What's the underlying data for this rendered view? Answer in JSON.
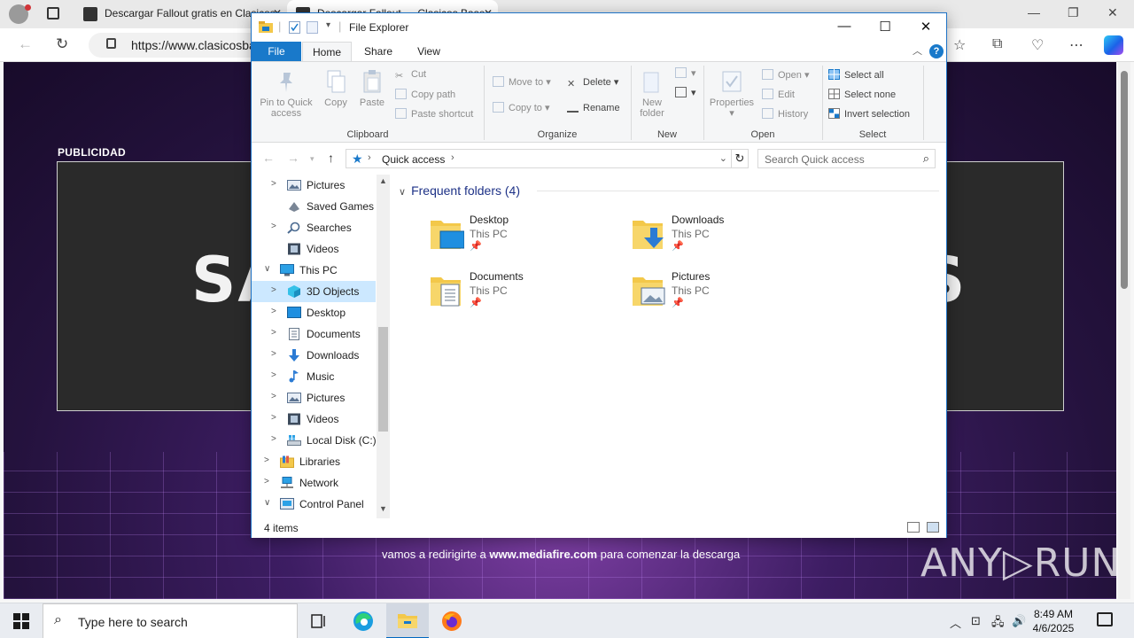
{
  "browser": {
    "tabs": [
      {
        "title": "Descargar Fallout gratis en Clasicos",
        "close": "✕"
      },
      {
        "title": "Descargar Fallout — Clasicos Base",
        "close": "✕"
      }
    ],
    "url": "https://www.clasicosba",
    "ad_label": "PUBLICIDAD",
    "hero_left": "SAY",
    "hero_right": "S",
    "redirect_text_pre": "vamos a redirigirte a",
    "redirect_site": "www.mediafire.com",
    "redirect_text_post": "para comenzar la descarga",
    "watermark": "ANY▷RUN"
  },
  "explorer": {
    "title": "File Explorer",
    "ribbon_tabs": {
      "file": "File",
      "home": "Home",
      "share": "Share",
      "view": "View"
    },
    "help": "?",
    "clipboard": {
      "pin": "Pin to Quick access",
      "copy": "Copy",
      "paste": "Paste",
      "cut": "Cut",
      "copy_path": "Copy path",
      "paste_shortcut": "Paste shortcut",
      "label": "Clipboard"
    },
    "organize": {
      "move_to": "Move to",
      "copy_to": "Copy to",
      "delete": "Delete",
      "rename": "Rename",
      "label": "Organize"
    },
    "new": {
      "new_folder": "New folder",
      "label": "New"
    },
    "open": {
      "properties": "Properties",
      "open": "Open",
      "edit": "Edit",
      "history": "History",
      "label": "Open"
    },
    "select": {
      "select_all": "Select all",
      "select_none": "Select none",
      "invert": "Invert selection",
      "label": "Select"
    },
    "address": {
      "crumb": "Quick access",
      "search_placeholder": "Search Quick access"
    },
    "tree": [
      {
        "label": "Pictures",
        "icon": "pictures-icon"
      },
      {
        "label": "Saved Games",
        "icon": "saved-games-icon"
      },
      {
        "label": "Searches",
        "icon": "searches-icon"
      },
      {
        "label": "Videos",
        "icon": "videos-icon"
      },
      {
        "label": "This PC",
        "icon": "this-pc-icon"
      },
      {
        "label": "3D Objects",
        "icon": "3d-objects-icon"
      },
      {
        "label": "Desktop",
        "icon": "desktop-icon"
      },
      {
        "label": "Documents",
        "icon": "documents-icon"
      },
      {
        "label": "Downloads",
        "icon": "downloads-icon"
      },
      {
        "label": "Music",
        "icon": "music-icon"
      },
      {
        "label": "Pictures",
        "icon": "pictures-icon"
      },
      {
        "label": "Videos",
        "icon": "videos-icon"
      },
      {
        "label": "Local Disk (C:)",
        "icon": "local-disk-icon"
      },
      {
        "label": "Libraries",
        "icon": "libraries-icon"
      },
      {
        "label": "Network",
        "icon": "network-icon"
      },
      {
        "label": "Control Panel",
        "icon": "control-panel-icon"
      }
    ],
    "frequent_header": "Frequent folders (4)",
    "folders": [
      {
        "name": "Desktop",
        "location": "This PC"
      },
      {
        "name": "Downloads",
        "location": "This PC"
      },
      {
        "name": "Documents",
        "location": "This PC"
      },
      {
        "name": "Pictures",
        "location": "This PC"
      }
    ],
    "status": "4 items"
  },
  "taskbar": {
    "search_placeholder": "Type here to search",
    "time": "8:49 AM",
    "date": "4/6/2025"
  },
  "colors": {
    "accent": "#1979ca",
    "selection": "#cce8ff",
    "folder": "#f3c84a"
  }
}
